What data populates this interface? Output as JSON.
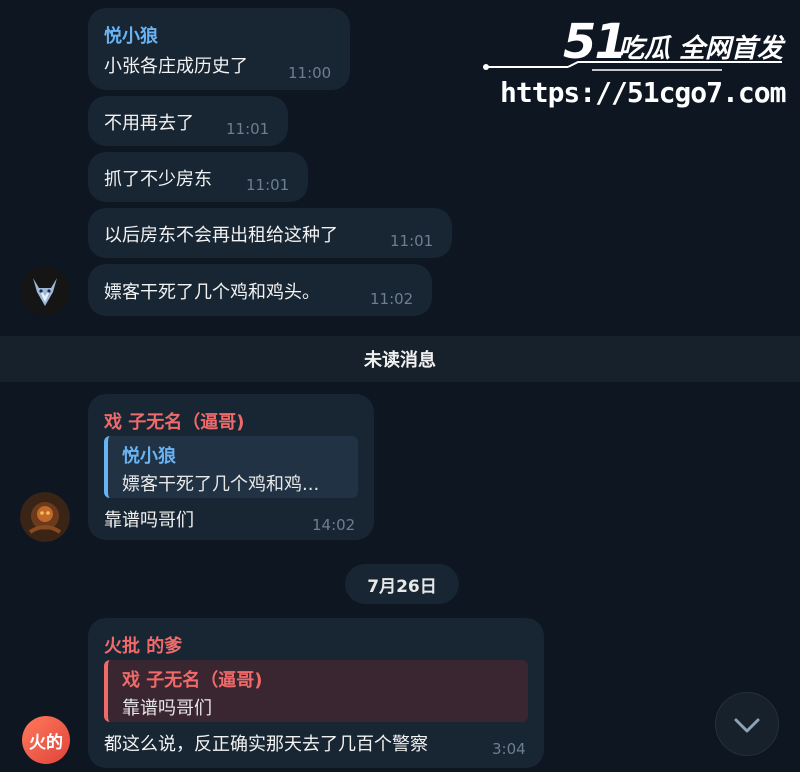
{
  "messages_top": [
    {
      "sender": "悦小狼",
      "text": "小张各庄成历史了",
      "time": "11:00"
    },
    {
      "text": "不用再去了",
      "time": "11:01"
    },
    {
      "text": "抓了不少房东",
      "time": "11:01"
    },
    {
      "text": "以后房东不会再出租给这种了",
      "time": "11:01"
    },
    {
      "text": "嫖客干死了几个鸡和鸡头。",
      "time": "11:02"
    }
  ],
  "unread_divider": "未读消息",
  "reply_message_1": {
    "sender": "戏 子无名（逼哥)",
    "quote_name": "悦小狼",
    "quote_text": "嫖客干死了几个鸡和鸡...",
    "text": "靠谱吗哥们",
    "time": "14:02"
  },
  "date_separator": "7月26日",
  "reply_message_2": {
    "sender": "火批 的爹",
    "quote_name": "戏 子无名（逼哥)",
    "quote_text": "靠谱吗哥们",
    "text": "都这么说，反正确实那天去了几百个警察",
    "time": "3:04",
    "avatar_text": "火的"
  },
  "watermark": {
    "logo": "51",
    "tagline": "吃瓜 全网首发",
    "url": "https://51cgo7.com"
  },
  "colors": {
    "background": "#0e1621",
    "bubble": "#182533",
    "sender_blue": "#6ab3f3",
    "sender_red": "#f06a6a",
    "timestamp": "#6d7f8f"
  },
  "icons": {
    "avatar_wolf": "wolf-avatar-icon",
    "avatar_game": "character-avatar-icon",
    "scroll_down": "chevron-down-icon"
  }
}
